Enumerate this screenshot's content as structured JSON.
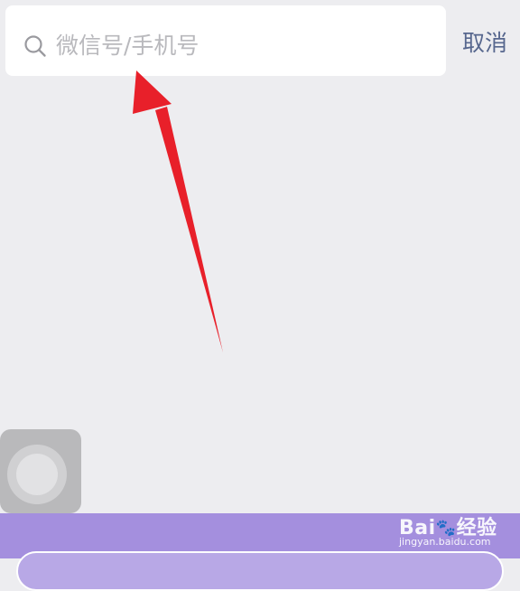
{
  "search": {
    "placeholder": "微信号/手机号",
    "value": "",
    "icon": "search-icon"
  },
  "header": {
    "cancel_label": "取消"
  },
  "overlay": {
    "arrow_color": "#e8202a"
  },
  "assistive_touch": {
    "icon": "assistive-touch-button"
  },
  "watermark": {
    "brand_prefix": "Bai",
    "brand_suffix": "经验",
    "paw": "🐾",
    "url": "jingyan.baidu.com"
  },
  "colors": {
    "background": "#ededf0",
    "accent_link": "#57678e",
    "bottom_band": "#a48fde"
  }
}
